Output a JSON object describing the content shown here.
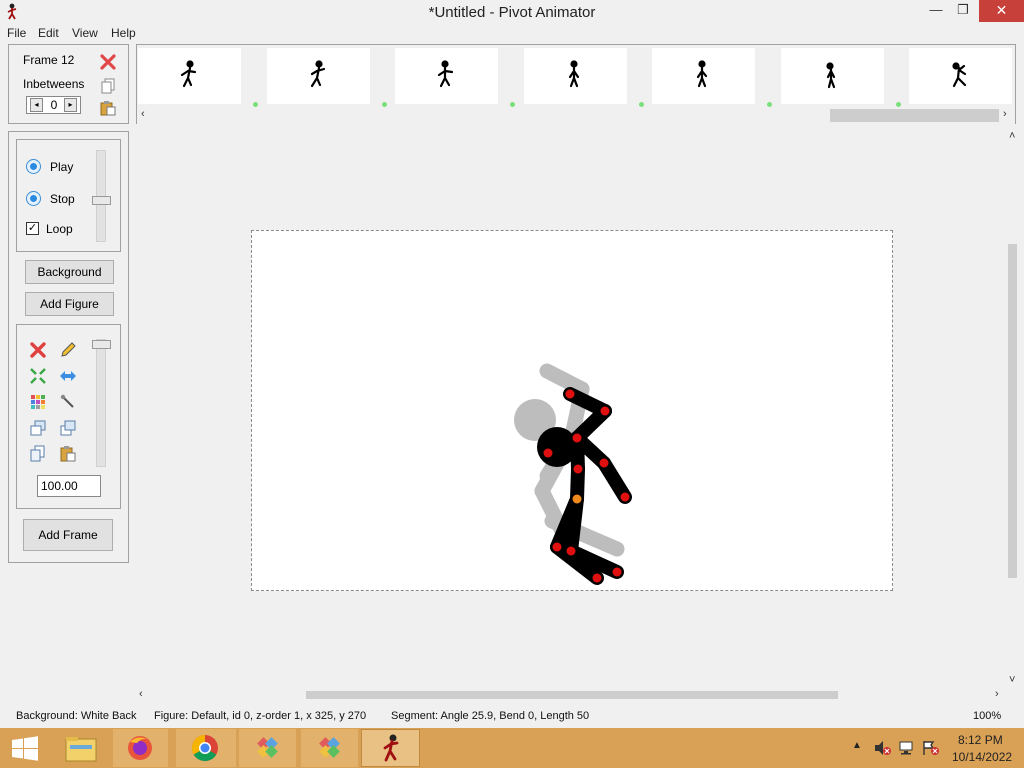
{
  "window": {
    "title": "*Untitled - Pivot Animator",
    "min": "—",
    "max": "❐",
    "close": "✕"
  },
  "menu": {
    "file": "File",
    "edit": "Edit",
    "view": "View",
    "help": "Help"
  },
  "frame_panel": {
    "frame_label": "Frame 12",
    "inbetweens_label": "Inbetweens",
    "inbetweens_value": "0",
    "icons": [
      "delete-frame-icon",
      "copy-icon",
      "paste-icon"
    ]
  },
  "filmstrip": {
    "frames": 7,
    "selected_frame_marker": "green-dot"
  },
  "playback": {
    "play": "Play",
    "stop": "Stop",
    "loop": "Loop",
    "loop_checked": "✓",
    "speed_level": 0.55
  },
  "buttons": {
    "background": "Background",
    "add_figure": "Add Figure",
    "add_frame": "Add Frame"
  },
  "figure_tools": {
    "icons": [
      "delete-figure-icon",
      "edit-figure-icon",
      "center-figure-icon",
      "flip-figure-icon",
      "color-figure-icon",
      "pick-tool-icon",
      "bring-front-icon",
      "send-back-icon",
      "copy-figure-icon",
      "paste-figure-icon"
    ],
    "scale": "100.00",
    "scale_level": 0.0
  },
  "status": {
    "background": "Background: White Back",
    "figure": "Figure: Default,  id 0,  z-order 1,  x 325, y 270",
    "segment": "Segment: Angle 25.9,  Bend 0,  Length 50",
    "zoom": "100%"
  },
  "taskbar": {
    "apps": [
      "windows-start",
      "file-explorer",
      "firefox",
      "chrome",
      "app-diamond-1",
      "app-diamond-2",
      "pivot-animator"
    ],
    "time": "8:12 PM",
    "date": "10/14/2022"
  },
  "colors": {
    "taskbar": "#d9a155",
    "joint_red": "#e01010",
    "joint_orange": "#f08a1c",
    "onion_skin": "#bdbdbd"
  }
}
